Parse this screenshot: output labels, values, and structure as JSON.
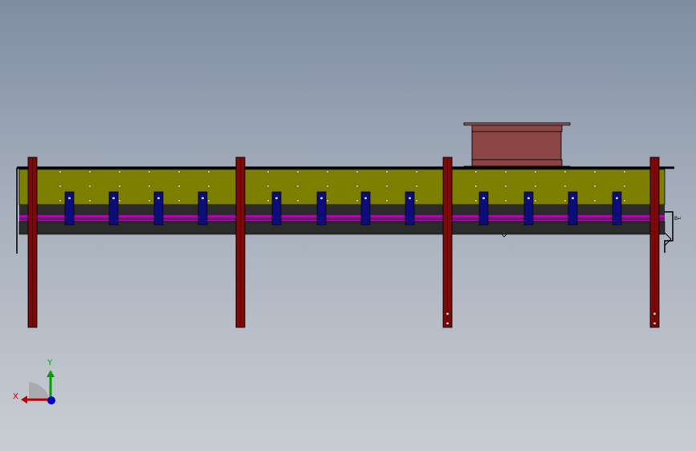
{
  "viewport": {
    "background_top": "#7f8da3",
    "background_bottom": "#c9cdd3"
  },
  "colors": {
    "panel": "#7d7f00",
    "dark_band": "#2b2b2b",
    "magenta_strip": "#b400b4",
    "legs": "#7a0a0a",
    "clamps": "#0d0d7a",
    "motor_box": "#8b4545",
    "outline": "#000000",
    "axis_x": "#c00000",
    "axis_y": "#00a000",
    "axis_z": "#0000c0"
  },
  "model": {
    "clamp_count": 12,
    "leg_count": 4
  },
  "triad": {
    "x_label": "X",
    "y_label": "Y",
    "x_icon": "x-axis-arrow-icon",
    "y_icon": "y-axis-arrow-icon",
    "z_icon": "z-axis-dot-icon"
  }
}
